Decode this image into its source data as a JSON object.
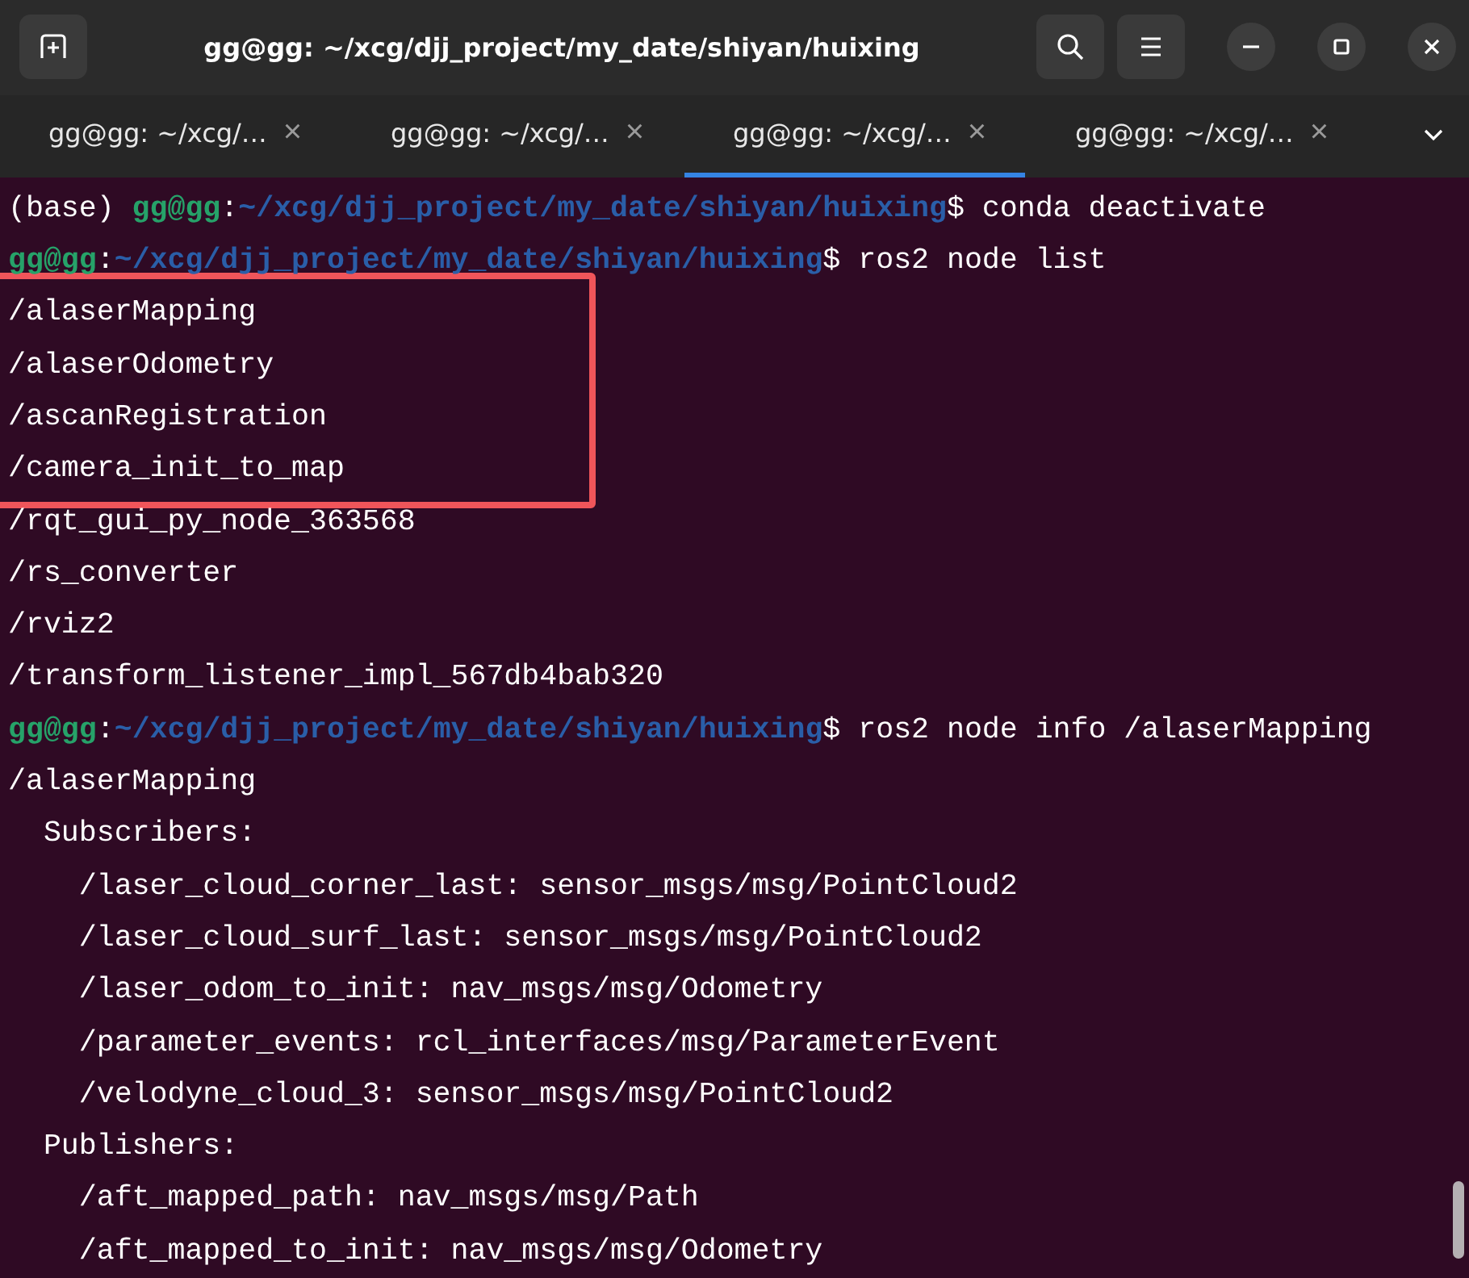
{
  "window": {
    "title": "gg@gg: ~/xcg/djj_project/my_date/shiyan/huixing"
  },
  "tabs": [
    {
      "label": "gg@gg: ~/xcg/…",
      "close": "×",
      "selected": false
    },
    {
      "label": "gg@gg: ~/xcg/…",
      "close": "×",
      "selected": false
    },
    {
      "label": "gg@gg: ~/xcg/…",
      "close": "×",
      "selected": true
    },
    {
      "label": "gg@gg: ~/xcg/…",
      "close": "×",
      "selected": false
    }
  ],
  "lines": [
    {
      "kind": "prompt",
      "env": "(base) ",
      "user": "gg@gg",
      "sep": ":",
      "path": "~/xcg/djj_project/my_date/shiyan/huixing",
      "end": "$",
      "command": " conda deactivate",
      "highlighted": false
    },
    {
      "kind": "prompt",
      "user": "gg@gg",
      "sep": ":",
      "path": "~/xcg/djj_project/my_date/shiyan/huixing",
      "end": "$",
      "command": " ros2 node list",
      "highlighted": false
    },
    {
      "kind": "output",
      "text": "/alaserMapping",
      "highlighted": true
    },
    {
      "kind": "output",
      "text": "/alaserOdometry",
      "highlighted": true
    },
    {
      "kind": "output",
      "text": "/ascanRegistration",
      "highlighted": true
    },
    {
      "kind": "output",
      "text": "/camera_init_to_map",
      "highlighted": true
    },
    {
      "kind": "output",
      "text": "/rqt_gui_py_node_363568",
      "highlighted": false
    },
    {
      "kind": "output",
      "text": "/rs_converter",
      "highlighted": false
    },
    {
      "kind": "output",
      "text": "/rviz2",
      "highlighted": false
    },
    {
      "kind": "output",
      "text": "/transform_listener_impl_567db4bab320",
      "highlighted": false
    },
    {
      "kind": "prompt",
      "user": "gg@gg",
      "sep": ":",
      "path": "~/xcg/djj_project/my_date/shiyan/huixing",
      "end": "$",
      "command": " ros2 node info /alaserMapping",
      "highlighted": false
    },
    {
      "kind": "output",
      "text": "/alaserMapping",
      "highlighted": false
    },
    {
      "kind": "output",
      "text": "  Subscribers:",
      "highlighted": false
    },
    {
      "kind": "output",
      "text": "    /laser_cloud_corner_last: sensor_msgs/msg/PointCloud2",
      "highlighted": false
    },
    {
      "kind": "output",
      "text": "    /laser_cloud_surf_last: sensor_msgs/msg/PointCloud2",
      "highlighted": false
    },
    {
      "kind": "output",
      "text": "    /laser_odom_to_init: nav_msgs/msg/Odometry",
      "highlighted": false
    },
    {
      "kind": "output",
      "text": "    /parameter_events: rcl_interfaces/msg/ParameterEvent",
      "highlighted": false
    },
    {
      "kind": "output",
      "text": "    /velodyne_cloud_3: sensor_msgs/msg/PointCloud2",
      "highlighted": false
    },
    {
      "kind": "output",
      "text": "  Publishers:",
      "highlighted": false
    },
    {
      "kind": "output",
      "text": "    /aft_mapped_path: nav_msgs/msg/Path",
      "highlighted": false
    },
    {
      "kind": "output",
      "text": "    /aft_mapped_to_init: nav_msgs/msg/Odometry",
      "highlighted": false
    }
  ]
}
